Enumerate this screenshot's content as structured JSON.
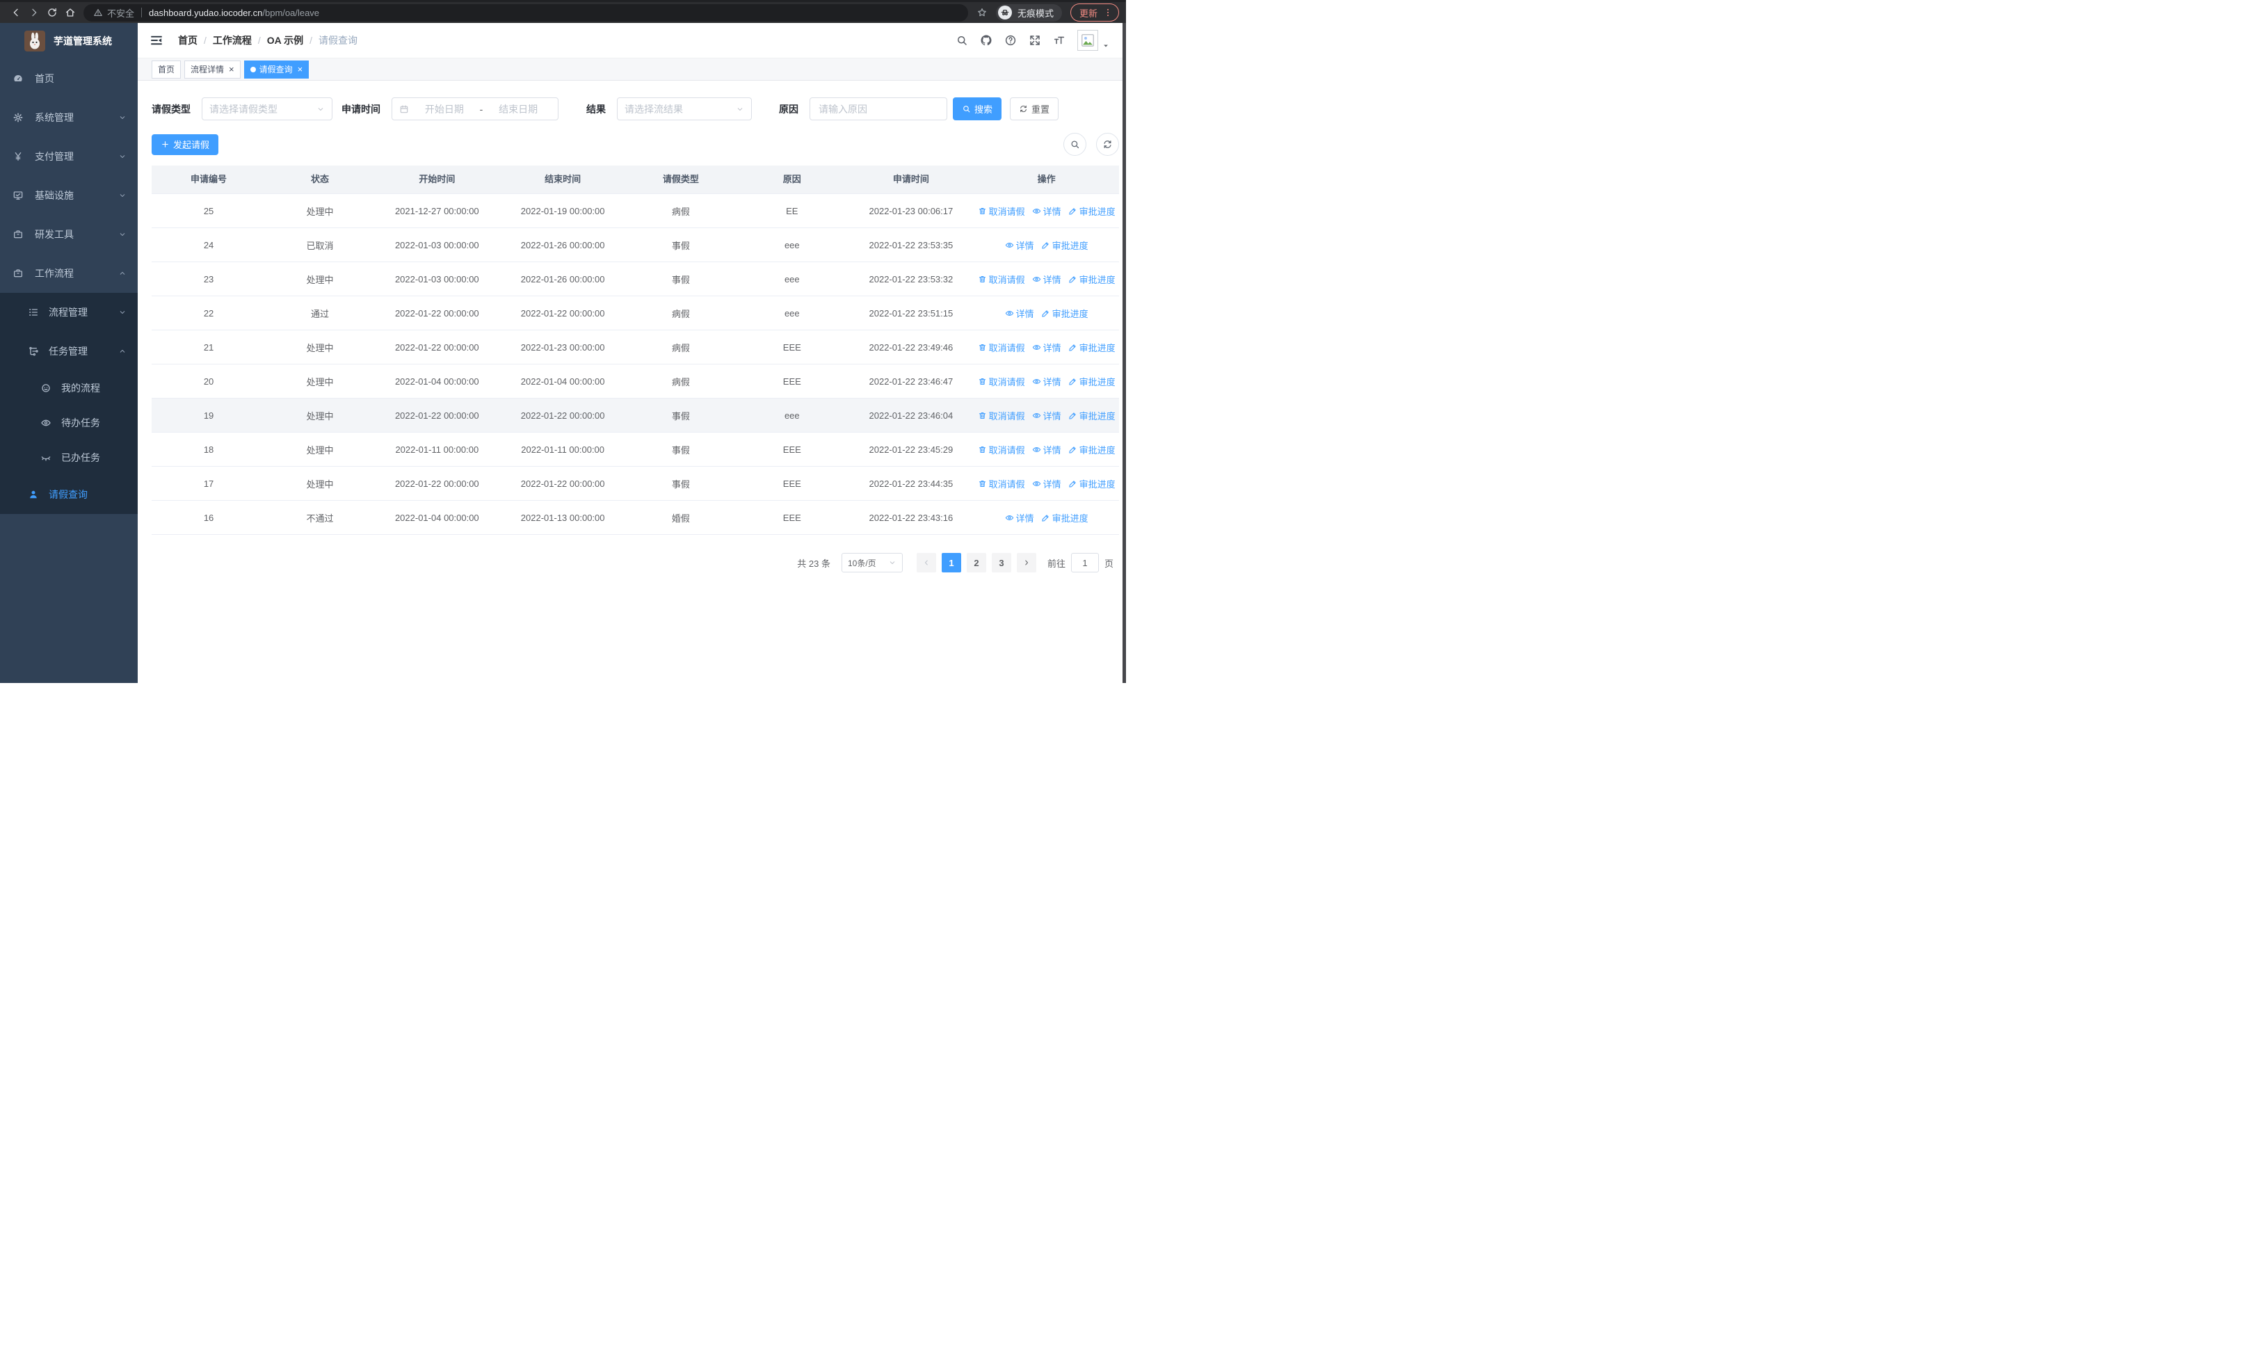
{
  "browser": {
    "security_label": "不安全",
    "url_host": "dashboard.yudao.iocoder.cn",
    "url_path": "/bpm/oa/leave",
    "incognito_label": "无痕模式",
    "update_label": "更新"
  },
  "sidebar": {
    "title": "芋道管理系统",
    "items": [
      {
        "name": "home",
        "icon": "dashboard",
        "label": "首页",
        "level": 1
      },
      {
        "name": "system",
        "icon": "gear",
        "label": "系统管理",
        "level": 1,
        "chevron": "down"
      },
      {
        "name": "payment",
        "icon": "yen",
        "label": "支付管理",
        "level": 1,
        "chevron": "down"
      },
      {
        "name": "infra",
        "icon": "monitor",
        "label": "基础设施",
        "level": 1,
        "chevron": "down"
      },
      {
        "name": "devtools",
        "icon": "briefcase",
        "label": "研发工具",
        "level": 1,
        "chevron": "down"
      },
      {
        "name": "workflow",
        "icon": "briefcase",
        "label": "工作流程",
        "level": 1,
        "chevron": "up"
      },
      {
        "name": "process-mgmt",
        "icon": "tree",
        "label": "流程管理",
        "level": 2,
        "dark": true,
        "chevron": "down"
      },
      {
        "name": "task-mgmt",
        "icon": "flow",
        "label": "任务管理",
        "level": 2,
        "dark": true,
        "chevron": "up"
      },
      {
        "name": "my-process",
        "icon": "face",
        "label": "我的流程",
        "level": 3,
        "dark": true
      },
      {
        "name": "todo-tasks",
        "icon": "eye",
        "label": "待办任务",
        "level": 3,
        "dark": true
      },
      {
        "name": "done-tasks",
        "icon": "eye-closed",
        "label": "已办任务",
        "level": 3,
        "dark": true
      },
      {
        "name": "leave-query",
        "icon": "user",
        "label": "请假查询",
        "level": 2,
        "dark": true,
        "active": true
      }
    ]
  },
  "breadcrumb": {
    "separator": "/",
    "items": [
      "首页",
      "工作流程",
      "OA 示例",
      "请假查询"
    ]
  },
  "tabs": [
    {
      "name": "home",
      "label": "首页",
      "closable": false,
      "active": false
    },
    {
      "name": "process-detail",
      "label": "流程详情",
      "closable": true,
      "active": false
    },
    {
      "name": "leave-query",
      "label": "请假查询",
      "closable": true,
      "active": true
    }
  ],
  "filters": {
    "leave_type": {
      "label": "请假类型",
      "placeholder": "请选择请假类型"
    },
    "apply_time": {
      "label": "申请时间",
      "start_placeholder": "开始日期",
      "separator": "-",
      "end_placeholder": "结束日期"
    },
    "result": {
      "label": "结果",
      "placeholder": "请选择流结果"
    },
    "reason": {
      "label": "原因",
      "placeholder": "请输入原因"
    },
    "search_label": "搜索",
    "reset_label": "重置"
  },
  "toolbar": {
    "create_label": "发起请假"
  },
  "table": {
    "columns": [
      "申请编号",
      "状态",
      "开始时间",
      "结束时间",
      "请假类型",
      "原因",
      "申请时间",
      "操作"
    ],
    "action_labels": {
      "cancel": "取消请假",
      "detail": "详情",
      "progress": "审批进度"
    },
    "action_icons": {
      "cancel": "trash",
      "detail": "view",
      "progress": "edit"
    },
    "rows": [
      {
        "id": "25",
        "status": "处理中",
        "start": "2021-12-27 00:00:00",
        "end": "2022-01-19 00:00:00",
        "type": "病假",
        "reason": "EE",
        "apply": "2022-01-23 00:06:17",
        "actions": [
          "cancel",
          "detail",
          "progress"
        ]
      },
      {
        "id": "24",
        "status": "已取消",
        "start": "2022-01-03 00:00:00",
        "end": "2022-01-26 00:00:00",
        "type": "事假",
        "reason": "eee",
        "apply": "2022-01-22 23:53:35",
        "actions": [
          "detail",
          "progress"
        ]
      },
      {
        "id": "23",
        "status": "处理中",
        "start": "2022-01-03 00:00:00",
        "end": "2022-01-26 00:00:00",
        "type": "事假",
        "reason": "eee",
        "apply": "2022-01-22 23:53:32",
        "actions": [
          "cancel",
          "detail",
          "progress"
        ]
      },
      {
        "id": "22",
        "status": "通过",
        "start": "2022-01-22 00:00:00",
        "end": "2022-01-22 00:00:00",
        "type": "病假",
        "reason": "eee",
        "apply": "2022-01-22 23:51:15",
        "actions": [
          "detail",
          "progress"
        ]
      },
      {
        "id": "21",
        "status": "处理中",
        "start": "2022-01-22 00:00:00",
        "end": "2022-01-23 00:00:00",
        "type": "病假",
        "reason": "EEE",
        "apply": "2022-01-22 23:49:46",
        "actions": [
          "cancel",
          "detail",
          "progress"
        ]
      },
      {
        "id": "20",
        "status": "处理中",
        "start": "2022-01-04 00:00:00",
        "end": "2022-01-04 00:00:00",
        "type": "病假",
        "reason": "EEE",
        "apply": "2022-01-22 23:46:47",
        "actions": [
          "cancel",
          "detail",
          "progress"
        ]
      },
      {
        "id": "19",
        "status": "处理中",
        "start": "2022-01-22 00:00:00",
        "end": "2022-01-22 00:00:00",
        "type": "事假",
        "reason": "eee",
        "apply": "2022-01-22 23:46:04",
        "actions": [
          "cancel",
          "detail",
          "progress"
        ],
        "highlight": true
      },
      {
        "id": "18",
        "status": "处理中",
        "start": "2022-01-11 00:00:00",
        "end": "2022-01-11 00:00:00",
        "type": "事假",
        "reason": "EEE",
        "apply": "2022-01-22 23:45:29",
        "actions": [
          "cancel",
          "detail",
          "progress"
        ]
      },
      {
        "id": "17",
        "status": "处理中",
        "start": "2022-01-22 00:00:00",
        "end": "2022-01-22 00:00:00",
        "type": "事假",
        "reason": "EEE",
        "apply": "2022-01-22 23:44:35",
        "actions": [
          "cancel",
          "detail",
          "progress"
        ]
      },
      {
        "id": "16",
        "status": "不通过",
        "start": "2022-01-04 00:00:00",
        "end": "2022-01-13 00:00:00",
        "type": "婚假",
        "reason": "EEE",
        "apply": "2022-01-22 23:43:16",
        "actions": [
          "detail",
          "progress"
        ]
      }
    ]
  },
  "pagination": {
    "total_label": "共 23 条",
    "page_size_label": "10条/页",
    "pages": [
      "1",
      "2",
      "3"
    ],
    "active_page": "1",
    "goto_label": "前往",
    "goto_value": "1",
    "unit_label": "页"
  },
  "colors": {
    "primary": "#409EFF",
    "sidebar_bg": "#304156",
    "sidebar_submenu_bg": "#1f2d3d",
    "update_accent": "#f28b82"
  }
}
